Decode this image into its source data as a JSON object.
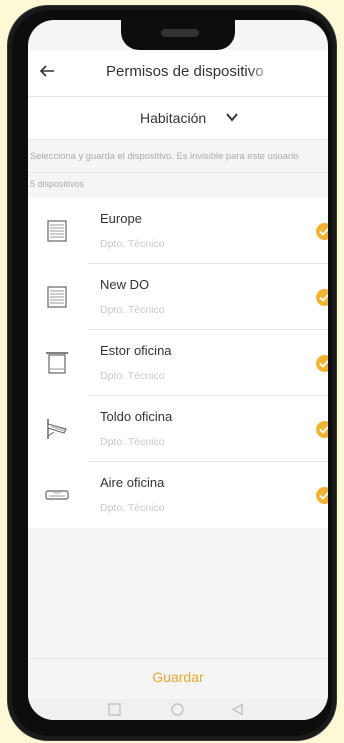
{
  "header": {
    "title": "Permisos de dispositivo"
  },
  "room": {
    "label": "Habitación"
  },
  "hint": "Selecciona y guarda el dispositivo. Es invisible para este usuario",
  "count": "5 dispositivos",
  "devices": [
    {
      "name": "Europe",
      "location": "Dpto. Técnico",
      "icon": "shutter-icon",
      "checked": true
    },
    {
      "name": "New DO",
      "location": "Dpto. Técnico",
      "icon": "shutter-icon",
      "checked": true
    },
    {
      "name": "Estor oficina",
      "location": "Dpto. Técnico",
      "icon": "roller-blind-icon",
      "checked": true
    },
    {
      "name": "Toldo oficina",
      "location": "Dpto. Técnico",
      "icon": "awning-icon",
      "checked": true
    },
    {
      "name": "Aire oficina",
      "location": "Dpto. Técnico",
      "icon": "air-conditioner-icon",
      "checked": true
    }
  ],
  "footer": {
    "save_label": "Guardar"
  },
  "colors": {
    "accent": "#f0b435",
    "save_text": "#e6a82f",
    "frame_bg": "#fdf9d6"
  }
}
